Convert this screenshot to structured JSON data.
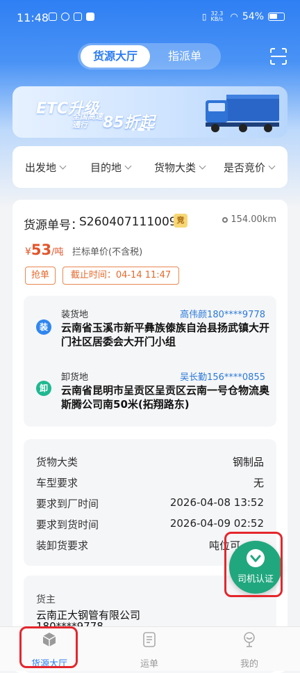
{
  "status_bar": {
    "time": "11:48",
    "net_speed": "32.3\nKB/s",
    "battery": "54%"
  },
  "header": {
    "tabs": [
      {
        "label": "货源大厅",
        "active": true
      },
      {
        "label": "指派单",
        "active": false
      }
    ],
    "scan_icon": "scan-icon"
  },
  "banner": {
    "line1": "ETC升级",
    "line2": "全国高速通行",
    "line3": "85折起"
  },
  "filters": [
    "出发地",
    "目的地",
    "货物大类",
    "是否竞价"
  ],
  "cargo": {
    "serial_label": "货源单号：",
    "serial_value": "S2604071110095",
    "bid_badge": "竞",
    "distance": "154.00km",
    "price_currency": "¥",
    "price_value": "53",
    "price_unit": "/吨",
    "price_note": "拦标单价(不含税)",
    "tags": [
      "抢单",
      "截止时间：04-14 11:47"
    ],
    "load": {
      "icon_text": "装",
      "title": "装货地",
      "contact": "高伟颜180****9778",
      "address": "云南省玉溪市新平彝族傣族自治县扬武镇大开门社区居委会大开门小组"
    },
    "unload": {
      "icon_text": "卸",
      "title": "卸货地",
      "contact": "吴长勤156****0855",
      "address": "云南省昆明市呈贡区呈贡区云南一号仓物流奥斯腾公司南50米(拓翔路东)"
    },
    "details": [
      {
        "label": "货物大类",
        "value": "钢制品"
      },
      {
        "label": "车型要求",
        "value": "无"
      },
      {
        "label": "要求到厂时间",
        "value": "2026-04-08 13:52"
      },
      {
        "label": "要求到货时间",
        "value": "2026-04-09 02:52"
      },
      {
        "label": "装卸货要求",
        "value": "吨位可"
      }
    ],
    "owner": {
      "label": "货主",
      "name": "云南正大钢管有限公司",
      "phone": "180****9778"
    }
  },
  "fab": {
    "label": "司机认证"
  },
  "tabbar": [
    {
      "label": "货源大厅",
      "active": true,
      "icon": "cube-icon"
    },
    {
      "label": "运单",
      "active": false,
      "icon": "document-icon"
    },
    {
      "label": "我的",
      "active": false,
      "icon": "profile-icon"
    }
  ],
  "colors": {
    "primary": "#2c7cf2",
    "price": "#e2542a",
    "tag": "#e46a2e",
    "fab": "#21a77e",
    "highlight": "#e4262c"
  }
}
